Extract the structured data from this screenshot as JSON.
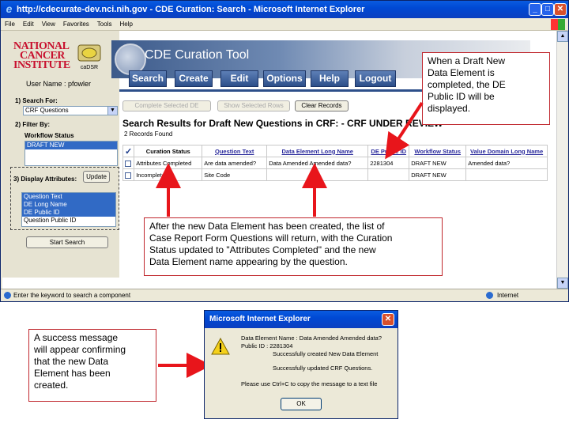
{
  "window": {
    "title": "http://cdecurate-dev.nci.nih.gov - CDE Curation: Search - Microsoft Internet Explorer",
    "menu": [
      "File",
      "Edit",
      "View",
      "Favorites",
      "Tools",
      "Help"
    ],
    "status_text": "Enter the keyword to search a component",
    "zone": "Internet"
  },
  "header": {
    "logo_lines": [
      "NATIONAL",
      "CANCER",
      "INSTITUTE"
    ],
    "cadsr_label": "caDSR",
    "app_title": "CDE Curation Tool",
    "user": "User Name : pfowler",
    "nav": [
      "Search",
      "Create",
      "Edit",
      "Options",
      "Help",
      "Logout"
    ]
  },
  "sidebar": {
    "search_for_label": "1) Search For:",
    "search_for_value": "CRF Questions",
    "filter_label": "2) Filter By:",
    "workflow_label": "Workflow Status",
    "workflow_options": [
      "DRAFT NEW"
    ],
    "display_label": "3) Display Attributes:",
    "update_label": "Update",
    "attributes": [
      "Question Text",
      "DE Long Name",
      "DE Public ID",
      "Question Public ID"
    ],
    "start_search_label": "Start Search"
  },
  "toolbar": {
    "complete_label": "Complete Selected DE",
    "show_selected_label": "Show Selected Rows",
    "clear_label": "Clear Records"
  },
  "results": {
    "title": "Search Results for Draft New Questions in CRF: - CRF UNDER REVIEW",
    "count": "2 Records Found",
    "headers": [
      "Curation Status",
      "Question Text",
      "Data Element Long Name",
      "DE Public ID",
      "Workflow Status",
      "Value Domain Long Name"
    ],
    "rows": [
      [
        "Attributes Completed",
        "Are data amended?",
        "Data Amended Amended data?",
        "2281304",
        "DRAFT NEW",
        "Amended data?"
      ],
      [
        "Incomplete",
        "Site Code",
        "",
        "",
        "DRAFT NEW",
        ""
      ]
    ]
  },
  "callouts": {
    "top_right": [
      "When a Draft New",
      "Data Element is",
      "completed, the DE",
      "Public ID will be",
      "displayed."
    ],
    "middle": [
      "After the new Data Element has been created, the list of",
      "Case Report Form Questions will return, with the Curation",
      "Status updated to \"Attributes Completed\" and the new",
      "Data Element name appearing by the question."
    ],
    "bottom_left": [
      "A success message",
      "will appear confirming",
      "that the new Data",
      "Element has been",
      "created."
    ]
  },
  "dialog": {
    "title": "Microsoft Internet Explorer",
    "line1": "Data Element Name : Data Amended Amended data?",
    "line2": "Public ID : 2281304",
    "line3": "Successfully created New Data Element",
    "line4": "Successfully updated CRF Questions.",
    "line5": "Please use Ctrl+C to copy the message to a text file",
    "ok_label": "OK"
  },
  "colors": {
    "callout_border": "#c0272d",
    "arrow": "#e8151b",
    "nav_button": "#2d4f8a",
    "title_bar": "#0049d4"
  }
}
